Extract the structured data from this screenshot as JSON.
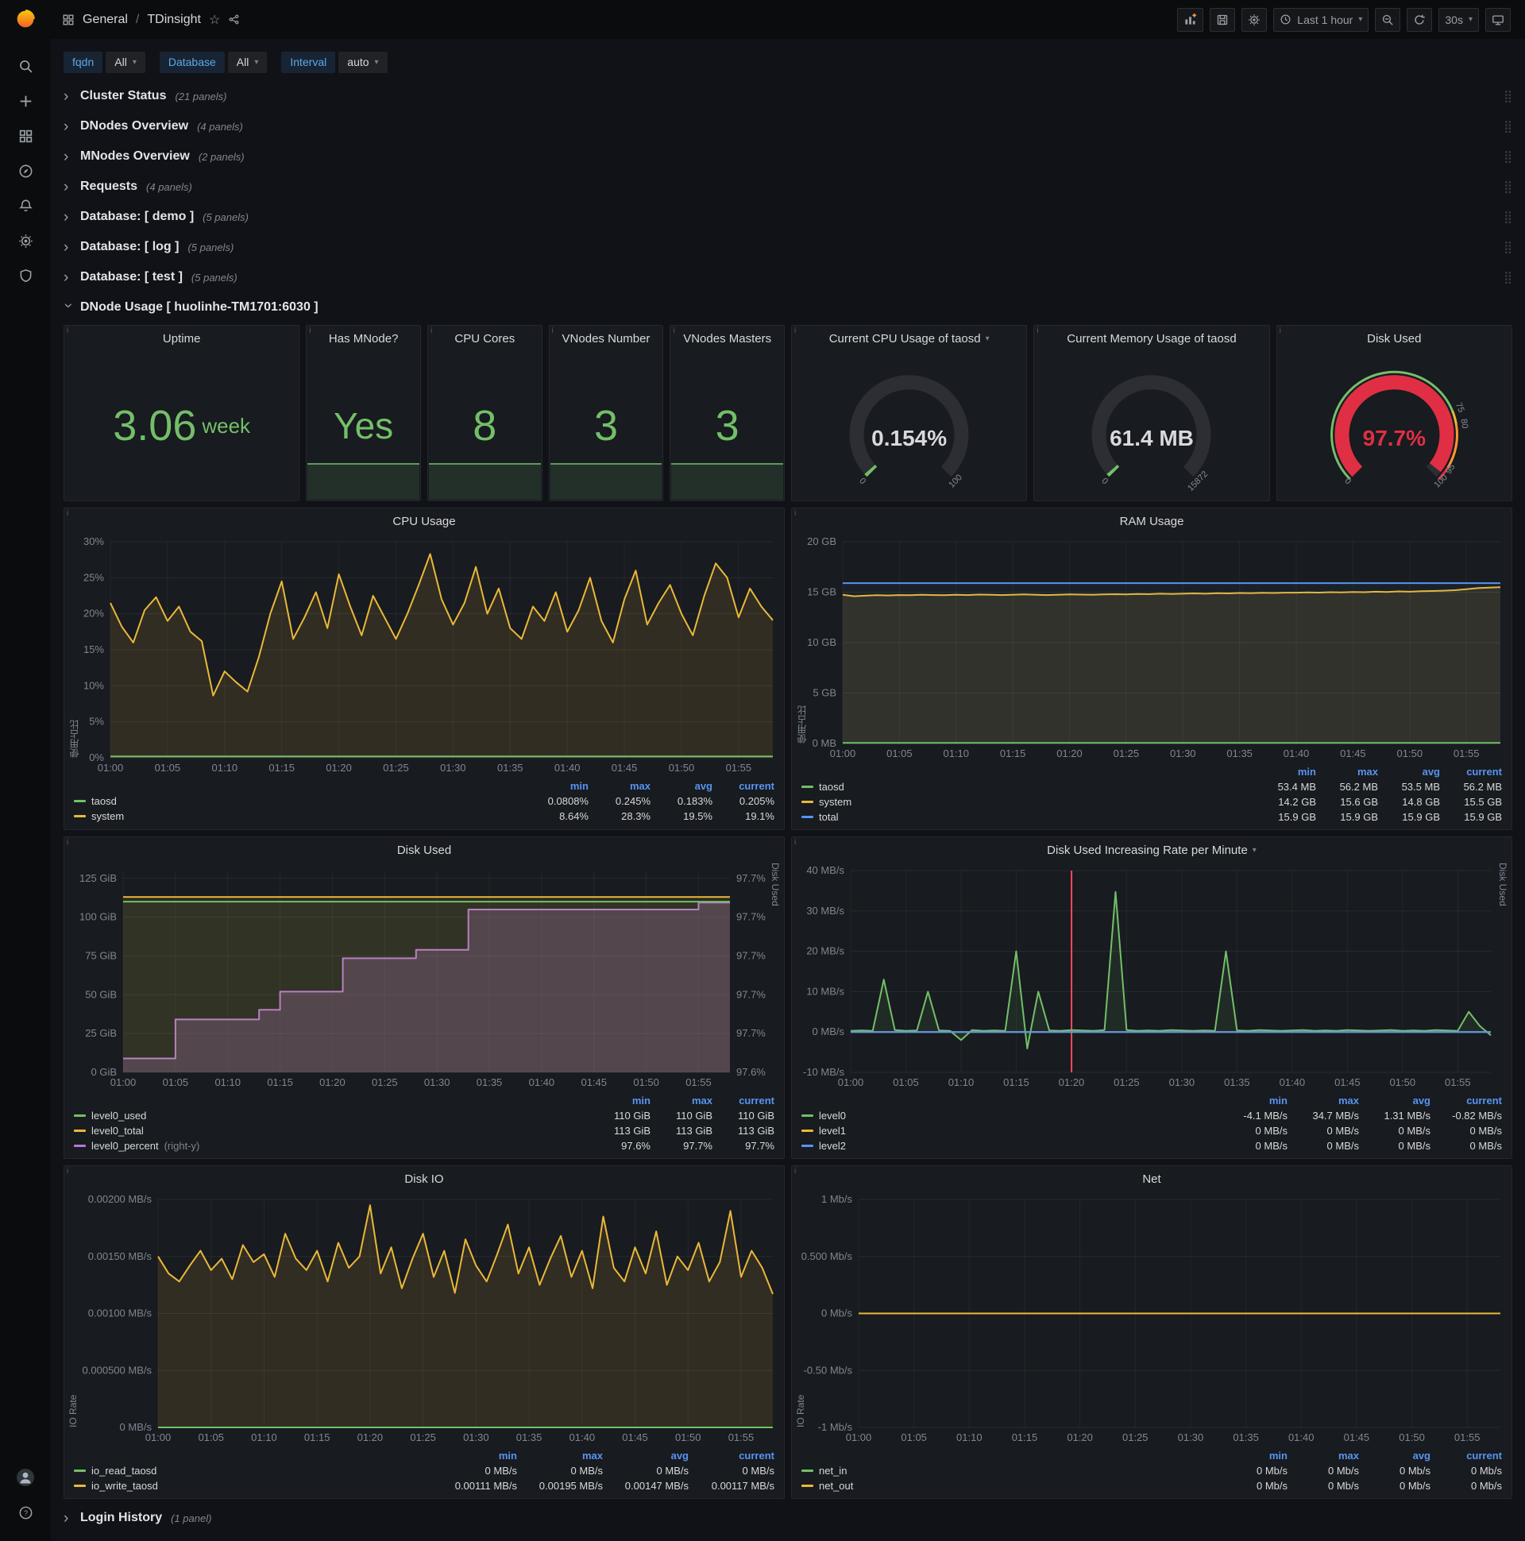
{
  "topnav": {
    "breadcrumb_section": "General",
    "breadcrumb_sep": "/",
    "breadcrumb_title": "TDinsight",
    "time_range": "Last 1 hour",
    "refresh_interval": "30s"
  },
  "variables": {
    "fqdn_label": "fqdn",
    "fqdn_value": "All",
    "db_label": "Database",
    "db_value": "All",
    "interval_label": "Interval",
    "interval_value": "auto"
  },
  "rows": [
    {
      "title": "Cluster Status",
      "count": "(21 panels)"
    },
    {
      "title": "DNodes Overview",
      "count": "(4 panels)"
    },
    {
      "title": "MNodes Overview",
      "count": "(2 panels)"
    },
    {
      "title": "Requests",
      "count": "(4 panels)"
    },
    {
      "title": "Database: [ demo ]",
      "count": "(5 panels)"
    },
    {
      "title": "Database: [ log ]",
      "count": "(5 panels)"
    },
    {
      "title": "Database: [ test ]",
      "count": "(5 panels)"
    }
  ],
  "dnode_row": {
    "title": "DNode Usage [ huolinhe-TM1701:6030 ]"
  },
  "login_row": {
    "title": "Login History",
    "count": "(1 panel)"
  },
  "stats": [
    {
      "title": "Uptime",
      "value": "3.06",
      "unit": "week"
    },
    {
      "title": "Has MNode?",
      "value": "Yes"
    },
    {
      "title": "CPU Cores",
      "value": "8"
    },
    {
      "title": "VNodes Number",
      "value": "3"
    },
    {
      "title": "VNodes Masters",
      "value": "3"
    }
  ],
  "gauges": [
    {
      "title": "Current CPU Usage of taosd",
      "value": "0.154%",
      "frac": 0.00154,
      "color": "#73BF69",
      "value_color": "#d8d9da",
      "ticks": [
        {
          "f": 0,
          "l": "0"
        },
        {
          "f": 1,
          "l": "100"
        }
      ]
    },
    {
      "title": "Current Memory Usage of taosd",
      "value": "61.4 MB",
      "frac": 0.0039,
      "color": "#73BF69",
      "value_color": "#d8d9da",
      "ticks": [
        {
          "f": 0,
          "l": "0"
        },
        {
          "f": 1,
          "l": "15872"
        }
      ]
    },
    {
      "title": "Disk Used",
      "value": "97.7%",
      "frac": 0.977,
      "color": "#E02F44",
      "value_color": "#E02F44",
      "threshold_ring": [
        {
          "to": 0.75,
          "c": "#73BF69"
        },
        {
          "to": 0.8,
          "c": "#EAB839"
        },
        {
          "to": 0.95,
          "c": "#FF9830"
        },
        {
          "to": 1,
          "c": "#E02F44"
        }
      ],
      "ticks": [
        {
          "f": 0,
          "l": "0"
        },
        {
          "f": 0.75,
          "l": "75"
        },
        {
          "f": 0.8,
          "l": "80"
        },
        {
          "f": 0.95,
          "l": "95"
        },
        {
          "f": 1,
          "l": "100"
        }
      ]
    }
  ],
  "time_ticks": [
    "01:00",
    "01:05",
    "01:10",
    "01:15",
    "01:20",
    "01:25",
    "01:30",
    "01:35",
    "01:40",
    "01:45",
    "01:50",
    "01:55"
  ],
  "chart_data": [
    {
      "type": "line",
      "title": "CPU Usage",
      "ylabel": "使用占比",
      "n": 59,
      "ylim": [
        0,
        30
      ],
      "yticks": [
        [
          0,
          "0%"
        ],
        [
          5,
          "5%"
        ],
        [
          10,
          "10%"
        ],
        [
          15,
          "15%"
        ],
        [
          20,
          "20%"
        ],
        [
          25,
          "25%"
        ],
        [
          30,
          "30%"
        ]
      ],
      "series": [
        {
          "name": "system",
          "color": "#EAB839",
          "fill": 0.12,
          "values": [
            21.5,
            18.2,
            16,
            20.5,
            22.3,
            19,
            21,
            17.5,
            16.2,
            8.64,
            12,
            10.5,
            9.2,
            14,
            20,
            24.5,
            16.5,
            19.5,
            23,
            18,
            25.5,
            21,
            17,
            22.5,
            19.5,
            16.5,
            20,
            24,
            28.3,
            22,
            18.5,
            21.5,
            26.5,
            20,
            23.5,
            18,
            16.5,
            21,
            19,
            23,
            17.5,
            20.5,
            25,
            19,
            16,
            22,
            26,
            18.5,
            21.5,
            24,
            20,
            17,
            22.5,
            27,
            25,
            19.5,
            23.5,
            21,
            19.1
          ]
        },
        {
          "name": "taosd",
          "color": "#73BF69",
          "fill": 0.1,
          "values": 0.2
        }
      ],
      "legend": {
        "columns": [
          "min",
          "max",
          "avg",
          "current"
        ],
        "rows": [
          {
            "name": "taosd",
            "color": "#73BF69",
            "values": [
              "0.0808%",
              "0.245%",
              "0.183%",
              "0.205%"
            ]
          },
          {
            "name": "system",
            "color": "#EAB839",
            "values": [
              "8.64%",
              "28.3%",
              "19.5%",
              "19.1%"
            ]
          }
        ]
      }
    },
    {
      "type": "line",
      "title": "RAM Usage",
      "ylabel": "使用占比",
      "n": 59,
      "ylim": [
        0,
        20
      ],
      "yticks": [
        [
          0,
          "0 MB"
        ],
        [
          5,
          "5 GB"
        ],
        [
          10,
          "10 GB"
        ],
        [
          15,
          "15 GB"
        ],
        [
          20,
          "20 GB"
        ]
      ],
      "series": [
        {
          "name": "system",
          "color": "#EAB839",
          "fill": 0.12,
          "values": [
            14.75,
            14.6,
            14.65,
            14.7,
            14.68,
            14.72,
            14.7,
            14.75,
            14.72,
            14.7,
            14.74,
            14.72,
            14.76,
            14.74,
            14.72,
            14.75,
            14.78,
            14.75,
            14.72,
            14.75,
            14.78,
            14.76,
            14.74,
            14.78,
            14.8,
            14.78,
            14.82,
            14.8,
            14.85,
            14.82,
            14.85,
            14.88,
            14.85,
            14.9,
            14.88,
            14.92,
            14.9,
            14.94,
            14.92,
            14.95,
            14.95,
            14.98,
            14.96,
            15,
            14.98,
            15.02,
            15,
            15.05,
            15.02,
            15.08,
            15.05,
            15.1,
            15.12,
            15.15,
            15.2,
            15.3,
            15.4,
            15.45,
            15.5
          ]
        },
        {
          "name": "total",
          "color": "#5794F2",
          "fill": 0.05,
          "values": 15.9
        },
        {
          "name": "taosd",
          "color": "#73BF69",
          "fill": 0.1,
          "values": 0.055
        }
      ],
      "legend": {
        "columns": [
          "min",
          "max",
          "avg",
          "current"
        ],
        "rows": [
          {
            "name": "taosd",
            "color": "#73BF69",
            "values": [
              "53.4 MB",
              "56.2 MB",
              "53.5 MB",
              "56.2 MB"
            ]
          },
          {
            "name": "system",
            "color": "#EAB839",
            "values": [
              "14.2 GB",
              "15.6 GB",
              "14.8 GB",
              "15.5 GB"
            ]
          },
          {
            "name": "total",
            "color": "#5794F2",
            "values": [
              "15.9 GB",
              "15.9 GB",
              "15.9 GB",
              "15.9 GB"
            ]
          }
        ]
      }
    },
    {
      "type": "line",
      "title": "Disk Used",
      "ylabel": "",
      "right_label": "Disk Used",
      "n": 59,
      "ylim": [
        0,
        130
      ],
      "yticks": [
        [
          0,
          "0 GiB"
        ],
        [
          25,
          "25 GiB"
        ],
        [
          50,
          "50 GiB"
        ],
        [
          75,
          "75 GiB"
        ],
        [
          100,
          "100 GiB"
        ],
        [
          125,
          "125 GiB"
        ]
      ],
      "rlim": [
        97.59,
        97.735
      ],
      "rticks": [
        "97.6%",
        "97.7%",
        "97.7%",
        "97.7%",
        "97.7%",
        "97.7%"
      ],
      "series": [
        {
          "name": "level0_percent",
          "color": "#B877D9",
          "fill": 0.25,
          "right": true,
          "step": true,
          "values": [
            97.6,
            97.6,
            97.6,
            97.6,
            97.6,
            97.628,
            97.628,
            97.628,
            97.628,
            97.628,
            97.628,
            97.628,
            97.628,
            97.635,
            97.635,
            97.648,
            97.648,
            97.648,
            97.648,
            97.648,
            97.648,
            97.672,
            97.672,
            97.672,
            97.672,
            97.672,
            97.672,
            97.672,
            97.678,
            97.678,
            97.678,
            97.678,
            97.678,
            97.707,
            97.707,
            97.707,
            97.707,
            97.707,
            97.707,
            97.707,
            97.707,
            97.707,
            97.707,
            97.707,
            97.707,
            97.707,
            97.707,
            97.707,
            97.707,
            97.707,
            97.707,
            97.707,
            97.707,
            97.707,
            97.707,
            97.712,
            97.712,
            97.712,
            97.712
          ]
        },
        {
          "name": "level0_total",
          "color": "#EAB839",
          "fill": 0.1,
          "values": 113
        },
        {
          "name": "level0_used",
          "color": "#73BF69",
          "fill": 0.06,
          "values": 110
        }
      ],
      "legend": {
        "columns": [
          "min",
          "max",
          "current"
        ],
        "rows": [
          {
            "name": "level0_used",
            "color": "#73BF69",
            "values": [
              "110 GiB",
              "110 GiB",
              "110 GiB"
            ]
          },
          {
            "name": "level0_total",
            "color": "#EAB839",
            "values": [
              "113 GiB",
              "113 GiB",
              "113 GiB"
            ]
          },
          {
            "name": "level0_percent",
            "suffix": "(right-y)",
            "color": "#B877D9",
            "values": [
              "97.6%",
              "97.7%",
              "97.7%"
            ]
          }
        ]
      }
    },
    {
      "type": "line",
      "title": "Disk Used Increasing Rate per Minute",
      "ylabel": "",
      "right_label": "Disk Used",
      "n": 59,
      "ylim": [
        -10,
        40
      ],
      "yticks": [
        [
          -10,
          "-10 MB/s"
        ],
        [
          0,
          "0 MB/s"
        ],
        [
          10,
          "10 MB/s"
        ],
        [
          20,
          "20 MB/s"
        ],
        [
          30,
          "30 MB/s"
        ],
        [
          40,
          "40 MB/s"
        ]
      ],
      "annotation": {
        "x_frac": 0.345,
        "color": "#F2495C"
      },
      "series": [
        {
          "name": "level0",
          "color": "#73BF69",
          "fill": 0.1,
          "values": [
            0.3,
            0.4,
            0.3,
            13,
            0.5,
            0.3,
            0.4,
            10,
            0.4,
            0.3,
            -2,
            0.5,
            0.3,
            0.4,
            0.3,
            20,
            -4.1,
            10,
            0.4,
            0.3,
            0.5,
            0.4,
            0.3,
            0.5,
            34.7,
            0.5,
            0.3,
            0.4,
            0.3,
            0.5,
            0.4,
            0.3,
            0.4,
            0.3,
            20,
            0.4,
            0.3,
            0.5,
            0.4,
            0.3,
            0.4,
            0.5,
            0.3,
            0.4,
            0.3,
            0.5,
            0.4,
            0.3,
            0.4,
            0.5,
            0.3,
            0.4,
            0.3,
            0.5,
            0.4,
            0.3,
            5,
            1.5,
            -0.82
          ]
        },
        {
          "name": "level1",
          "color": "#EAB839",
          "fill": 0,
          "values": 0
        },
        {
          "name": "level2",
          "color": "#5794F2",
          "fill": 0,
          "values": 0
        }
      ],
      "legend": {
        "columns": [
          "min",
          "max",
          "avg",
          "current"
        ],
        "rows": [
          {
            "name": "level0",
            "color": "#73BF69",
            "values": [
              "-4.1 MB/s",
              "34.7 MB/s",
              "1.31 MB/s",
              "-0.82 MB/s"
            ]
          },
          {
            "name": "level1",
            "color": "#EAB839",
            "values": [
              "0 MB/s",
              "0 MB/s",
              "0 MB/s",
              "0 MB/s"
            ]
          },
          {
            "name": "level2",
            "color": "#5794F2",
            "values": [
              "0 MB/s",
              "0 MB/s",
              "0 MB/s",
              "0 MB/s"
            ]
          }
        ]
      }
    },
    {
      "type": "line",
      "title": "Disk IO",
      "ylabel": "IO Rate",
      "n": 59,
      "ylim": [
        0,
        0.002
      ],
      "yticks": [
        [
          0,
          "0 MB/s"
        ],
        [
          0.0005,
          "0.000500 MB/s"
        ],
        [
          0.001,
          "0.00100 MB/s"
        ],
        [
          0.0015,
          "0.00150 MB/s"
        ],
        [
          0.002,
          "0.00200 MB/s"
        ]
      ],
      "series": [
        {
          "name": "io_write_taosd",
          "color": "#EAB839",
          "fill": 0.12,
          "values": [
            0.0015,
            0.00135,
            0.00128,
            0.00142,
            0.00155,
            0.00138,
            0.00148,
            0.0013,
            0.0016,
            0.00145,
            0.00152,
            0.00132,
            0.0017,
            0.00148,
            0.00138,
            0.00155,
            0.00128,
            0.00162,
            0.0014,
            0.0015,
            0.00195,
            0.00135,
            0.00158,
            0.00122,
            0.00148,
            0.0017,
            0.00132,
            0.00155,
            0.00118,
            0.00165,
            0.00142,
            0.00128,
            0.00152,
            0.00178,
            0.00135,
            0.00158,
            0.00125,
            0.00148,
            0.00168,
            0.00132,
            0.00155,
            0.00122,
            0.00185,
            0.0014,
            0.00128,
            0.00158,
            0.00135,
            0.00172,
            0.00125,
            0.0015,
            0.00138,
            0.00162,
            0.00128,
            0.00145,
            0.0019,
            0.00132,
            0.00155,
            0.0014,
            0.00117
          ]
        },
        {
          "name": "io_read_taosd",
          "color": "#73BF69",
          "fill": 0.08,
          "values": 0
        }
      ],
      "legend": {
        "columns": [
          "min",
          "max",
          "avg",
          "current"
        ],
        "rows": [
          {
            "name": "io_read_taosd",
            "color": "#73BF69",
            "values": [
              "0 MB/s",
              "0 MB/s",
              "0 MB/s",
              "0 MB/s"
            ]
          },
          {
            "name": "io_write_taosd",
            "color": "#EAB839",
            "values": [
              "0.00111 MB/s",
              "0.00195 MB/s",
              "0.00147 MB/s",
              "0.00117 MB/s"
            ]
          }
        ]
      }
    },
    {
      "type": "line",
      "title": "Net",
      "ylabel": "IO Rate",
      "n": 59,
      "ylim": [
        -1,
        1
      ],
      "yticks": [
        [
          -1,
          "-1 Mb/s"
        ],
        [
          -0.5,
          "-0.50 Mb/s"
        ],
        [
          0,
          "0 Mb/s"
        ],
        [
          0.5,
          "0.500 Mb/s"
        ],
        [
          1,
          "1 Mb/s"
        ]
      ],
      "series": [
        {
          "name": "net_in",
          "color": "#73BF69",
          "fill": 0,
          "values": 0
        },
        {
          "name": "net_out",
          "color": "#EAB839",
          "fill": 0,
          "values": 0
        }
      ],
      "legend": {
        "columns": [
          "min",
          "max",
          "avg",
          "current"
        ],
        "rows": [
          {
            "name": "net_in",
            "color": "#73BF69",
            "values": [
              "0 Mb/s",
              "0 Mb/s",
              "0 Mb/s",
              "0 Mb/s"
            ]
          },
          {
            "name": "net_out",
            "color": "#EAB839",
            "values": [
              "0 Mb/s",
              "0 Mb/s",
              "0 Mb/s",
              "0 Mb/s"
            ]
          }
        ]
      }
    }
  ]
}
